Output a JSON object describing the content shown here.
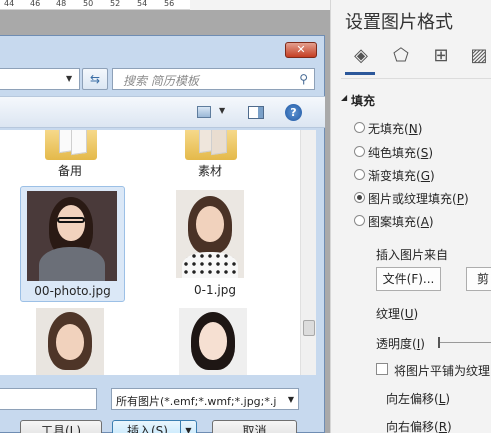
{
  "ruler": {
    "ticks": [
      "44",
      "46",
      "48",
      "50",
      "52",
      "54",
      "56"
    ]
  },
  "dialog": {
    "close_label": "✕",
    "search_placeholder": "搜索 简历模板",
    "folders": [
      {
        "label": "备用"
      },
      {
        "label": "素材"
      }
    ],
    "files": [
      {
        "label": "00-photo.jpg",
        "selected": true
      },
      {
        "label": "0-1.jpg",
        "selected": false
      },
      {
        "label": "",
        "selected": false
      },
      {
        "label": "",
        "selected": false
      }
    ],
    "file_type_filter": "所有图片(*.emf;*.wmf;*.jpg;*.j",
    "tools_label": "工具(L)",
    "insert_label": "插入(S)",
    "cancel_label": "取消"
  },
  "format_pane": {
    "title": "设置图片格式",
    "tabs": [
      "fill-line-icon",
      "effects-icon",
      "layout-size-icon",
      "picture-icon"
    ],
    "fill_section": "填充",
    "fill_options": [
      {
        "label": "无填充",
        "key": "N",
        "selected": false
      },
      {
        "label": "纯色填充",
        "key": "S",
        "selected": false
      },
      {
        "label": "渐变填充",
        "key": "G",
        "selected": false
      },
      {
        "label": "图片或纹理填充",
        "key": "P",
        "selected": true
      },
      {
        "label": "图案填充",
        "key": "A",
        "selected": false
      }
    ],
    "insert_from": "插入图片来自",
    "file_button": "文件(F)...",
    "second_button": "剪",
    "texture_label": "纹理",
    "texture_key": "U",
    "transparency_label": "透明度",
    "transparency_key": "I",
    "tile_label": "将图片平铺为纹理(I",
    "offset_left": "向左偏移",
    "offset_left_key": "L",
    "offset_right": "向右偏移",
    "offset_right_key": "R"
  },
  "colors": {
    "accent": "#2b579a",
    "selection": "#dbe8f7"
  }
}
